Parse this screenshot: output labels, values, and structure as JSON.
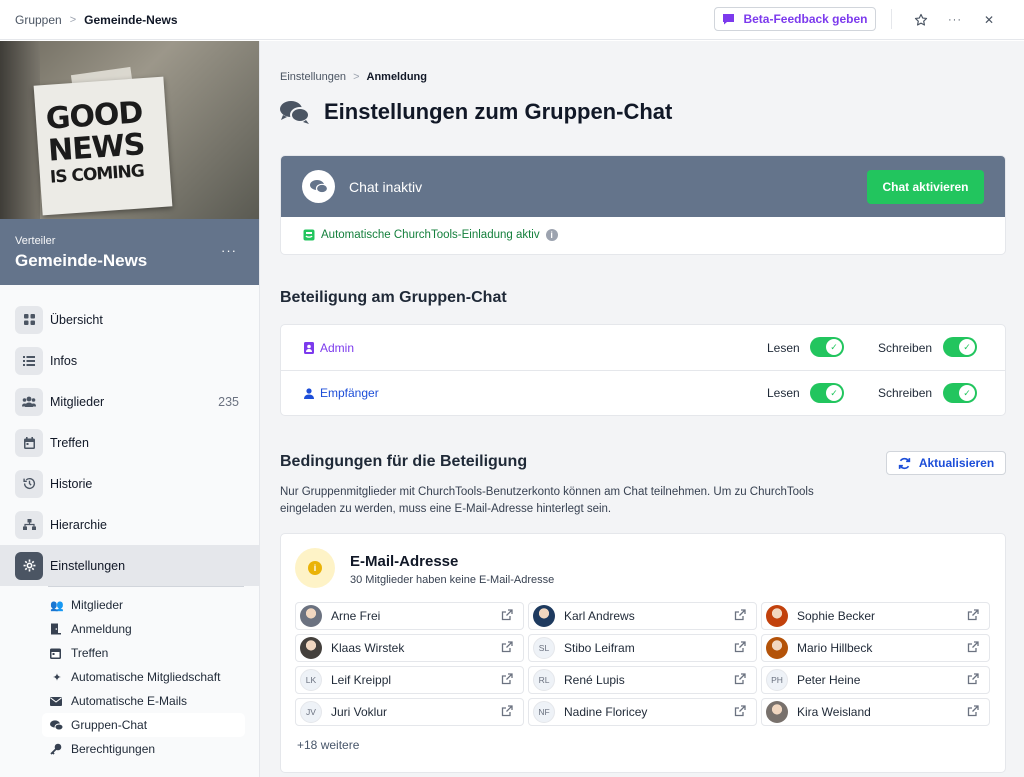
{
  "topbar": {
    "breadcrumb_root": "Gruppen",
    "breadcrumb_current": "Gemeinde-News",
    "beta_feedback": "Beta-Feedback geben",
    "more": "···",
    "close": "✕"
  },
  "sidebar": {
    "hero_text": [
      "GOOD",
      "NEWS",
      "IS COMING"
    ],
    "group_type": "Verteiler",
    "group_name": "Gemeinde-News",
    "more": "···",
    "nav": [
      {
        "label": "Übersicht",
        "icon": "grid-icon"
      },
      {
        "label": "Infos",
        "icon": "list-icon"
      },
      {
        "label": "Mitglieder",
        "icon": "users-icon",
        "count": "235"
      },
      {
        "label": "Treffen",
        "icon": "calendar-icon"
      },
      {
        "label": "Historie",
        "icon": "history-icon"
      },
      {
        "label": "Hierarchie",
        "icon": "hierarchy-icon"
      },
      {
        "label": "Einstellungen",
        "icon": "gear-icon"
      }
    ],
    "settings_sub": [
      {
        "label": "Mitglieder",
        "icon": "users-icon"
      },
      {
        "label": "Anmeldung",
        "icon": "door-icon"
      },
      {
        "label": "Treffen",
        "icon": "calendar-icon"
      },
      {
        "label": "Automatische Mitgliedschaft",
        "icon": "sparkles-icon"
      },
      {
        "label": "Automatische E-Mails",
        "icon": "envelope-icon"
      },
      {
        "label": "Gruppen-Chat",
        "icon": "chat-icon"
      },
      {
        "label": "Berechtigungen",
        "icon": "key-icon"
      }
    ]
  },
  "main": {
    "breadcrumb_root": "Einstellungen",
    "breadcrumb_current": "Anmeldung",
    "title": "Einstellungen zum Gruppen-Chat",
    "chat": {
      "status": "Chat inaktiv",
      "activate": "Chat aktivieren",
      "invite": "Automatische ChurchTools-Einladung aktiv"
    },
    "participation": {
      "title": "Beteiligung am Gruppen-Chat",
      "read_label": "Lesen",
      "write_label": "Schreiben",
      "roles": [
        {
          "name": "Admin",
          "color": "#7c3aed",
          "read": true,
          "write": true
        },
        {
          "name": "Empfänger",
          "color": "#1d4ed8",
          "read": true,
          "write": true
        }
      ]
    },
    "conditions": {
      "title": "Bedingungen für die Beteiligung",
      "refresh": "Aktualisieren",
      "text": "Nur Gruppenmitglieder mit ChurchTools-Benutzerkonto können am Chat teilnehmen. Um zu ChurchTools eingeladen zu werden, muss eine E-Mail-Adresse hinterlegt sein."
    },
    "email": {
      "title": "E-Mail-Adresse",
      "subtitle": "30 Mitglieder haben keine E-Mail-Adresse",
      "members": [
        {
          "name": "Arne Frei",
          "initials": "",
          "photo": "#6b7280"
        },
        {
          "name": "Karl Andrews",
          "initials": "",
          "photo": "#1e3a5f"
        },
        {
          "name": "Sophie Becker",
          "initials": "",
          "photo": "#c2410c"
        },
        {
          "name": "Klaas Wirstek",
          "initials": "",
          "photo": "#44403c"
        },
        {
          "name": "Stibo Leifram",
          "initials": "SL",
          "photo": ""
        },
        {
          "name": "Mario Hillbeck",
          "initials": "",
          "photo": "#b45309"
        },
        {
          "name": "Leif Kreippl",
          "initials": "LK",
          "photo": ""
        },
        {
          "name": "René Lupis",
          "initials": "RL",
          "photo": ""
        },
        {
          "name": "Peter Heine",
          "initials": "PH",
          "photo": ""
        },
        {
          "name": "Juri Voklur",
          "initials": "JV",
          "photo": ""
        },
        {
          "name": "Nadine Floricey",
          "initials": "NF",
          "photo": ""
        },
        {
          "name": "Kira Weisland",
          "initials": "",
          "photo": "#78716c"
        }
      ],
      "more": "+18 weitere"
    }
  }
}
